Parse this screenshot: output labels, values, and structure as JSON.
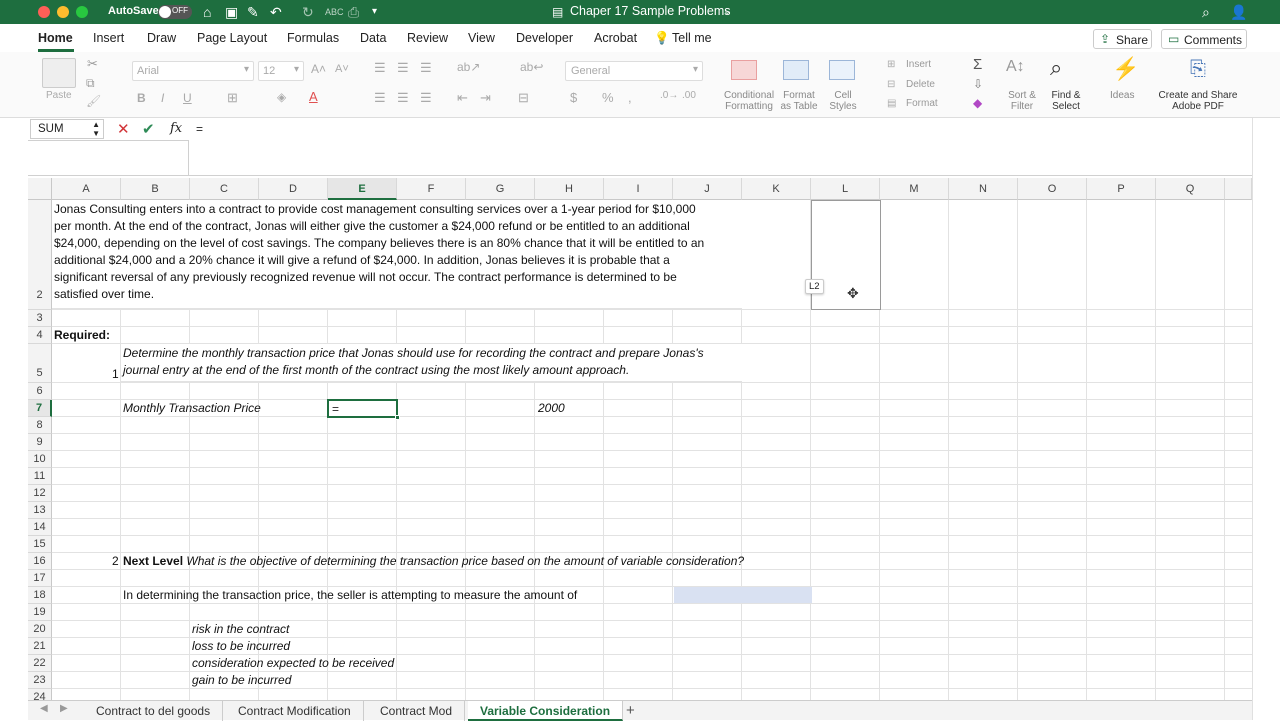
{
  "titlebar": {
    "autosave": "AutoSave",
    "autosave_state": "OFF",
    "doc_title": "Chaper 17 Sample Problems",
    "title_color": "#1e6e3f"
  },
  "ribbon_tabs": [
    "Home",
    "Insert",
    "Draw",
    "Page Layout",
    "Formulas",
    "Data",
    "Review",
    "View",
    "Developer",
    "Acrobat"
  ],
  "tell_me": "Tell me",
  "share": "Share",
  "comments": "Comments",
  "ribbon": {
    "paste": "Paste",
    "font": "Arial",
    "size": "12",
    "number_format": "General",
    "conditional_formatting": [
      "Conditional",
      "Formatting"
    ],
    "format_as_table": [
      "Format",
      "as Table"
    ],
    "cell_styles": [
      "Cell",
      "Styles"
    ],
    "insert": "Insert",
    "delete": "Delete",
    "format": "Format",
    "sort_filter": [
      "Sort &",
      "Filter"
    ],
    "find_select": [
      "Find &",
      "Select"
    ],
    "ideas": "Ideas",
    "create_share": [
      "Create and Share",
      "Adobe PDF"
    ]
  },
  "formula_bar": {
    "name_box": "SUM",
    "fx": "fx",
    "formula": "="
  },
  "columns": [
    "A",
    "B",
    "C",
    "D",
    "E",
    "F",
    "G",
    "H",
    "I",
    "J",
    "K",
    "L",
    "M",
    "N",
    "O",
    "P",
    "Q"
  ],
  "rows": [
    "2",
    "3",
    "4",
    "5",
    "6",
    "7",
    "8",
    "9",
    "10",
    "11",
    "12",
    "13",
    "14",
    "15",
    "16",
    "17",
    "18",
    "19",
    "20",
    "21",
    "22",
    "23",
    "24"
  ],
  "cells": {
    "a2_lines": [
      "Jonas Consulting enters into a contract to provide cost management consulting services over a 1-year period for $10,000",
      "per month. At the end of the contract, Jonas will either give the customer a $24,000 refund or be entitled to an additional",
      "$24,000, depending on the level of cost savings. The company believes there is an 80% chance that it will be entitled to an",
      "additional $24,000 and a 20% chance it will give a refund of $24,000. In addition, Jonas believes it is probable that a",
      "significant reversal of any previously recognized revenue will not occur. The contract performance is determined to be",
      "satisfied over time."
    ],
    "a4": "Required:",
    "a5": "1",
    "b5_lines": [
      "Determine the monthly transaction price that Jonas should use for recording the contract and prepare Jonas's",
      "journal entry at the end of the first month of the contract using the most likely amount approach."
    ],
    "b7": "Monthly Transaction Price",
    "e7": "=",
    "h7": "2000",
    "a16": "2",
    "b16_bold": "Next Level",
    "b16_rest": "What is the objective of determining the transaction price based on the amount of variable consideration?",
    "b18": "In determining the transaction price, the seller is attempting to measure the amount of",
    "c20": "risk in the contract",
    "c21": "loss to be incurred",
    "c22": "consideration expected to be received",
    "c23": "gain to be incurred",
    "tooltip_l2": "L2"
  },
  "sheet_tabs": [
    "Contract to del goods",
    "Contract Modification",
    "Contract Mod",
    "Variable Consideration"
  ],
  "active_sheet": "Variable Consideration"
}
